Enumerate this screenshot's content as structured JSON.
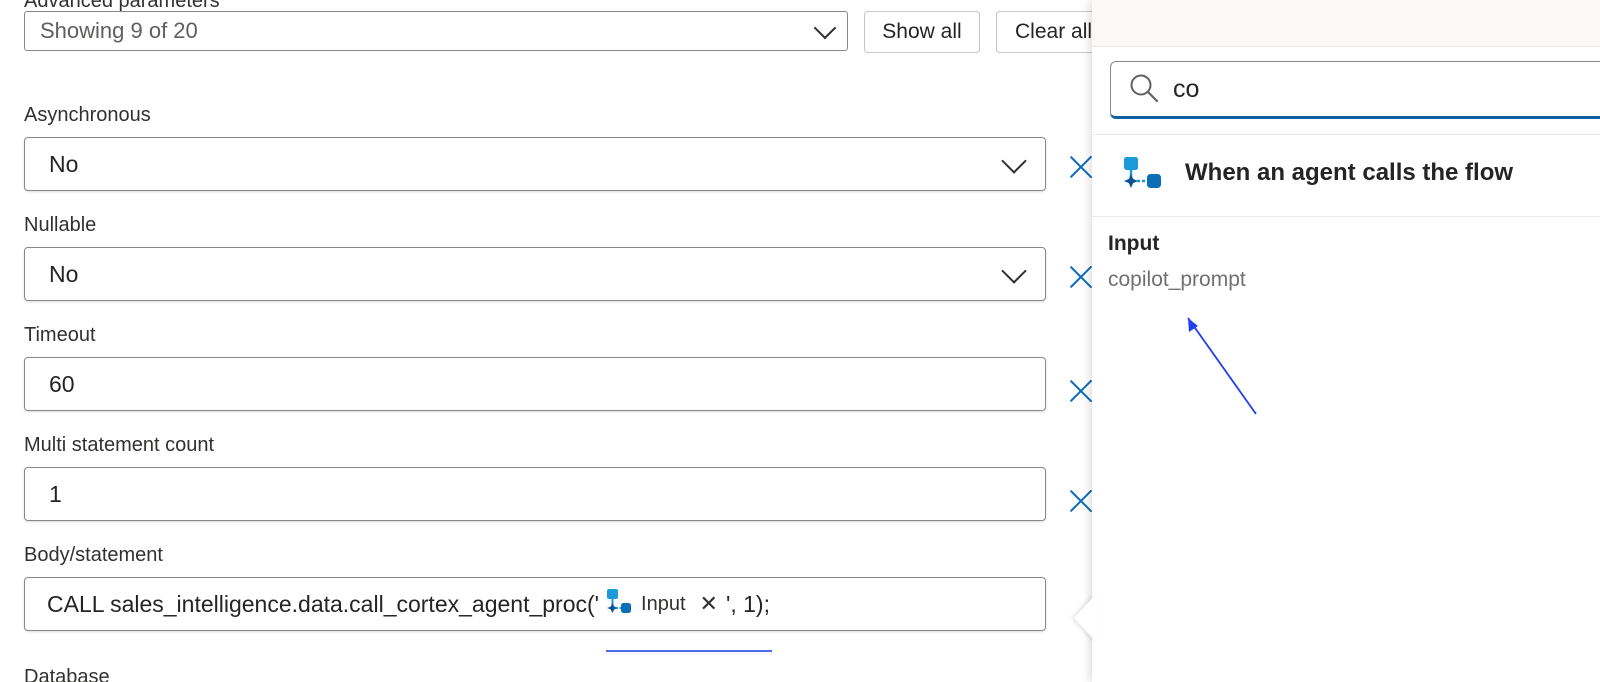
{
  "form": {
    "advanced_label": "Advanced parameters",
    "showing": "Showing 9 of 20",
    "show_all_label": "Show all",
    "clear_all_label": "Clear all",
    "fields": {
      "asynchronous": {
        "label": "Asynchronous",
        "value": "No"
      },
      "nullable": {
        "label": "Nullable",
        "value": "No"
      },
      "timeout": {
        "label": "Timeout",
        "value": "60"
      },
      "multi_statement": {
        "label": "Multi statement count",
        "value": "1"
      },
      "body": {
        "label": "Body/statement",
        "prefix": "CALL sales_intelligence.data.call_cortex_agent_proc('",
        "token_label": "Input",
        "token_remove": "✕",
        "suffix": "', 1);"
      },
      "database": {
        "label": "Database"
      }
    }
  },
  "panel": {
    "search_value": "co",
    "trigger_title": "When an agent calls the flow",
    "section_title": "Input",
    "items": [
      "copilot_prompt"
    ]
  },
  "colors": {
    "accent": "#0f6cbd",
    "search_underline": "#115ea3",
    "trigger_icon": "#1a9bd7",
    "annotation_arrow": "#1f3ff0"
  },
  "icons": {
    "dropdown": "chevron-down-icon",
    "remove": "close-icon",
    "search": "search-icon",
    "trigger": "agent-flow-icon"
  }
}
